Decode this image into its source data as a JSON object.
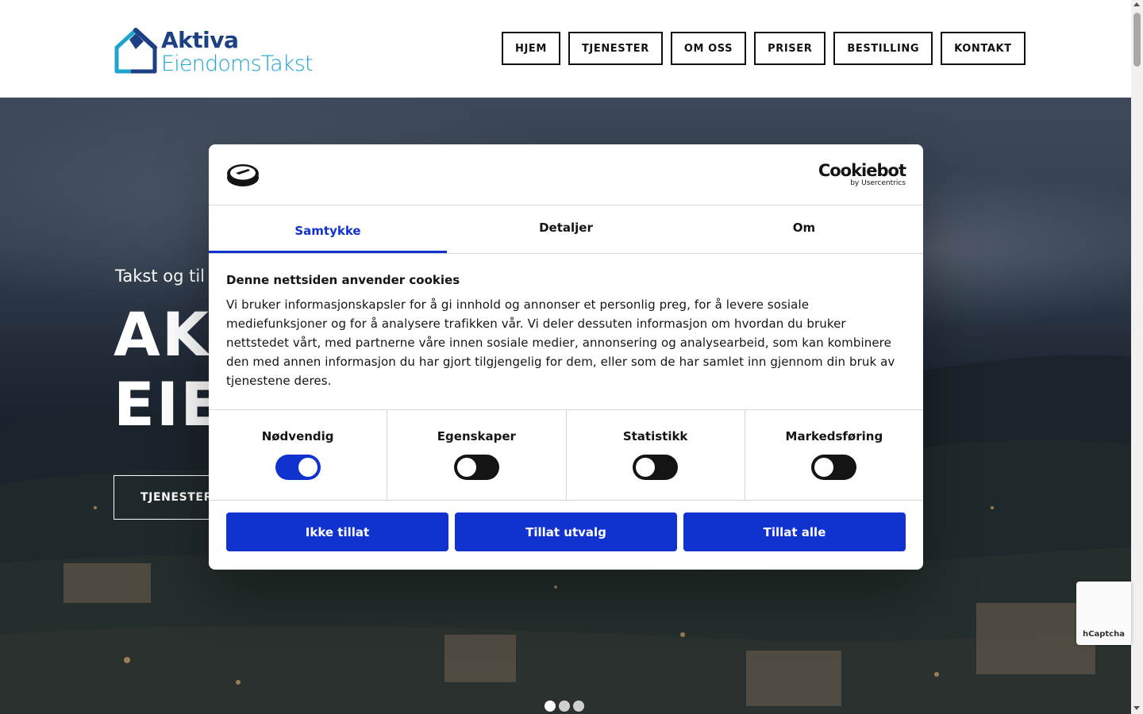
{
  "header": {
    "logo_line1": "Aktiva",
    "logo_line2": "EiendomsTakst",
    "nav": [
      "HJEM",
      "TJENESTER",
      "OM OSS",
      "PRISER",
      "BESTILLING",
      "KONTAKT"
    ]
  },
  "hero": {
    "subtitle": "Takst og til",
    "title_line1": "AKT",
    "title_line2": "EIE",
    "button_label": "TJENESTER",
    "slide_count": 3,
    "active_slide": 1
  },
  "cookie_dialog": {
    "brand": "Cookiebot",
    "brand_sub": "by Usercentrics",
    "tabs": [
      "Samtykke",
      "Detaljer",
      "Om"
    ],
    "active_tab": "Samtykke",
    "heading": "Denne nettsiden anvender cookies",
    "body": "Vi bruker informasjonskapsler for å gi innhold og annonser et personlig preg, for å levere sosiale mediefunksjoner og for å analysere trafikken vår. Vi deler dessuten informasjon om hvordan du bruker nettstedet vårt, med partnerne våre innen sosiale medier, annonsering og analysearbeid, som kan kombinere den med annen informasjon du har gjort tilgjengelig for dem, eller som de har samlet inn gjennom din bruk av tjenestene deres.",
    "toggles": [
      {
        "label": "Nødvendig",
        "on": true
      },
      {
        "label": "Egenskaper",
        "on": false
      },
      {
        "label": "Statistikk",
        "on": false
      },
      {
        "label": "Markedsføring",
        "on": false
      }
    ],
    "buttons": [
      "Ikke tillat",
      "Tillat utvalg",
      "Tillat alle"
    ]
  },
  "captcha_badge": "hCaptcha",
  "colors": {
    "accent": "#1032cf",
    "logo_dark": "#1d3f83",
    "logo_light": "#1fa3cf"
  }
}
